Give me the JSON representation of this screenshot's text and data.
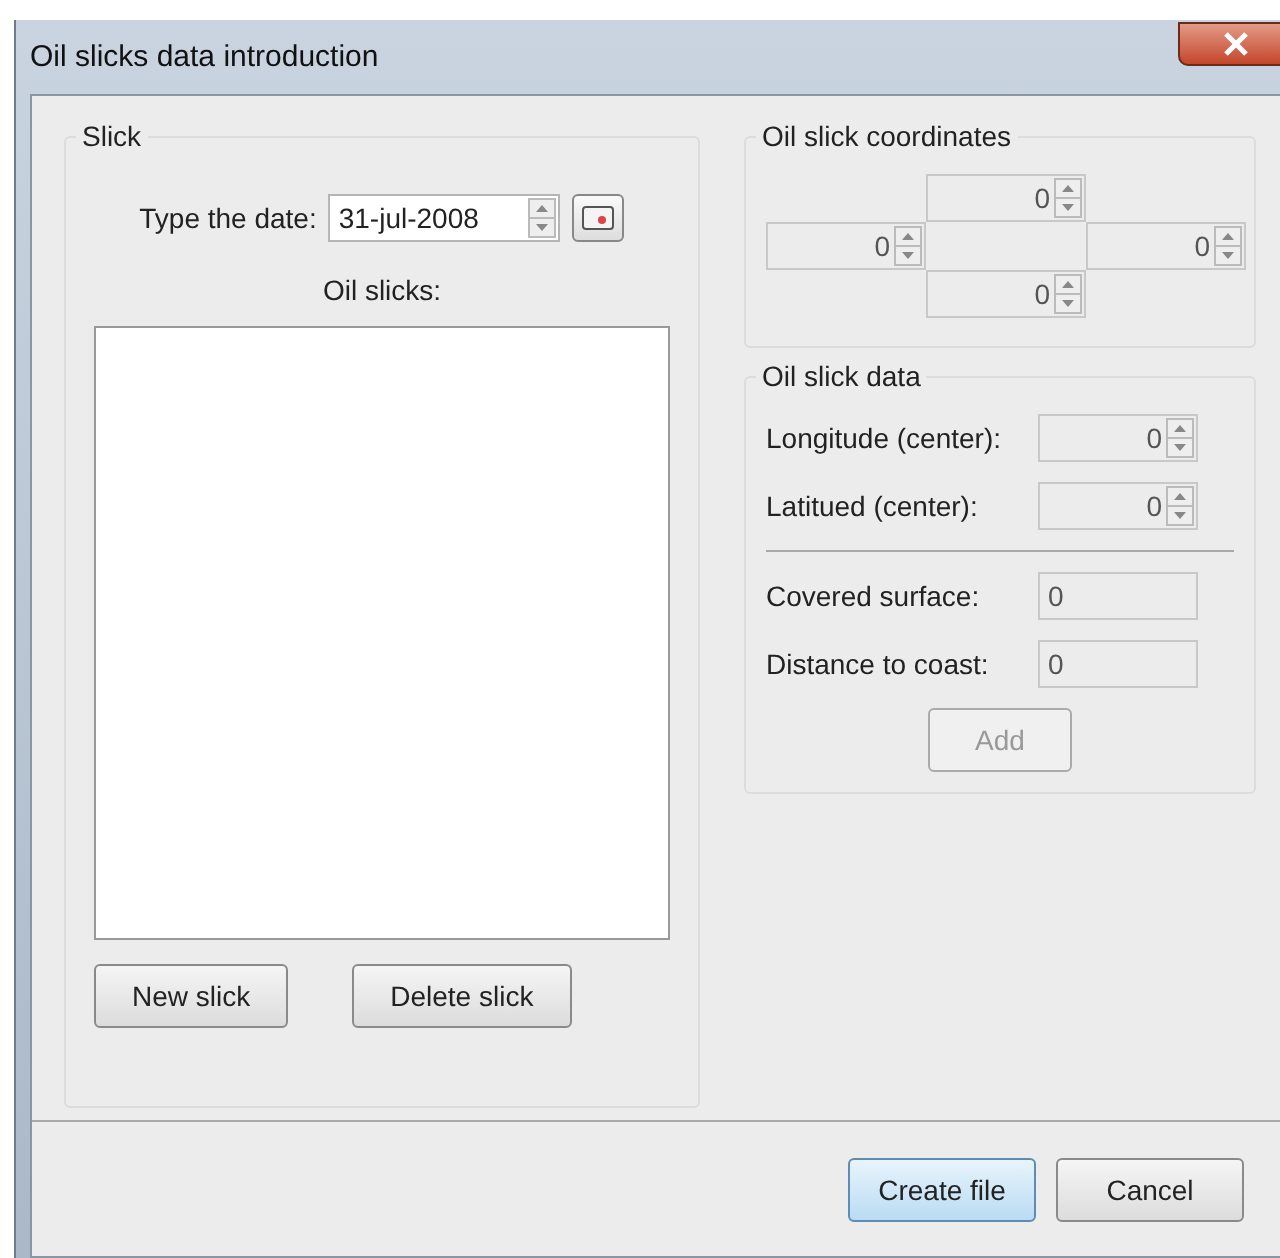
{
  "window": {
    "title": "Oil slicks data introduction"
  },
  "slick": {
    "title": "Slick",
    "date_label": "Type the date:",
    "date_value": "31-jul-2008",
    "list_label": "Oil slicks:",
    "buttons": [
      {
        "label": "New slick"
      },
      {
        "label": "Delete slick"
      }
    ]
  },
  "coordinates": {
    "title": "Oil slick coordinates",
    "fields": [
      {
        "value": "0",
        "disabled": true
      },
      {
        "value": "0",
        "disabled": true
      },
      {
        "value": "0",
        "disabled": true
      },
      {
        "value": "0",
        "disabled": true
      }
    ]
  },
  "data": {
    "title": "Oil slick data",
    "fields": [
      {
        "kind": "spin",
        "label": "Longitude (center):",
        "value": "0",
        "disabled": true
      },
      {
        "kind": "spin",
        "label": "Latitued (center):",
        "value": "0",
        "disabled": true
      },
      {
        "kind": "text",
        "label": "Covered surface:",
        "value": "0",
        "disabled": true
      },
      {
        "kind": "text",
        "label": "Distance to coast:",
        "value": "0",
        "disabled": true
      }
    ],
    "add": {
      "label": "Add",
      "disabled": true
    }
  },
  "footer": {
    "buttons": [
      {
        "label": "Create file",
        "default": true
      },
      {
        "label": "Cancel",
        "default": false
      }
    ]
  }
}
